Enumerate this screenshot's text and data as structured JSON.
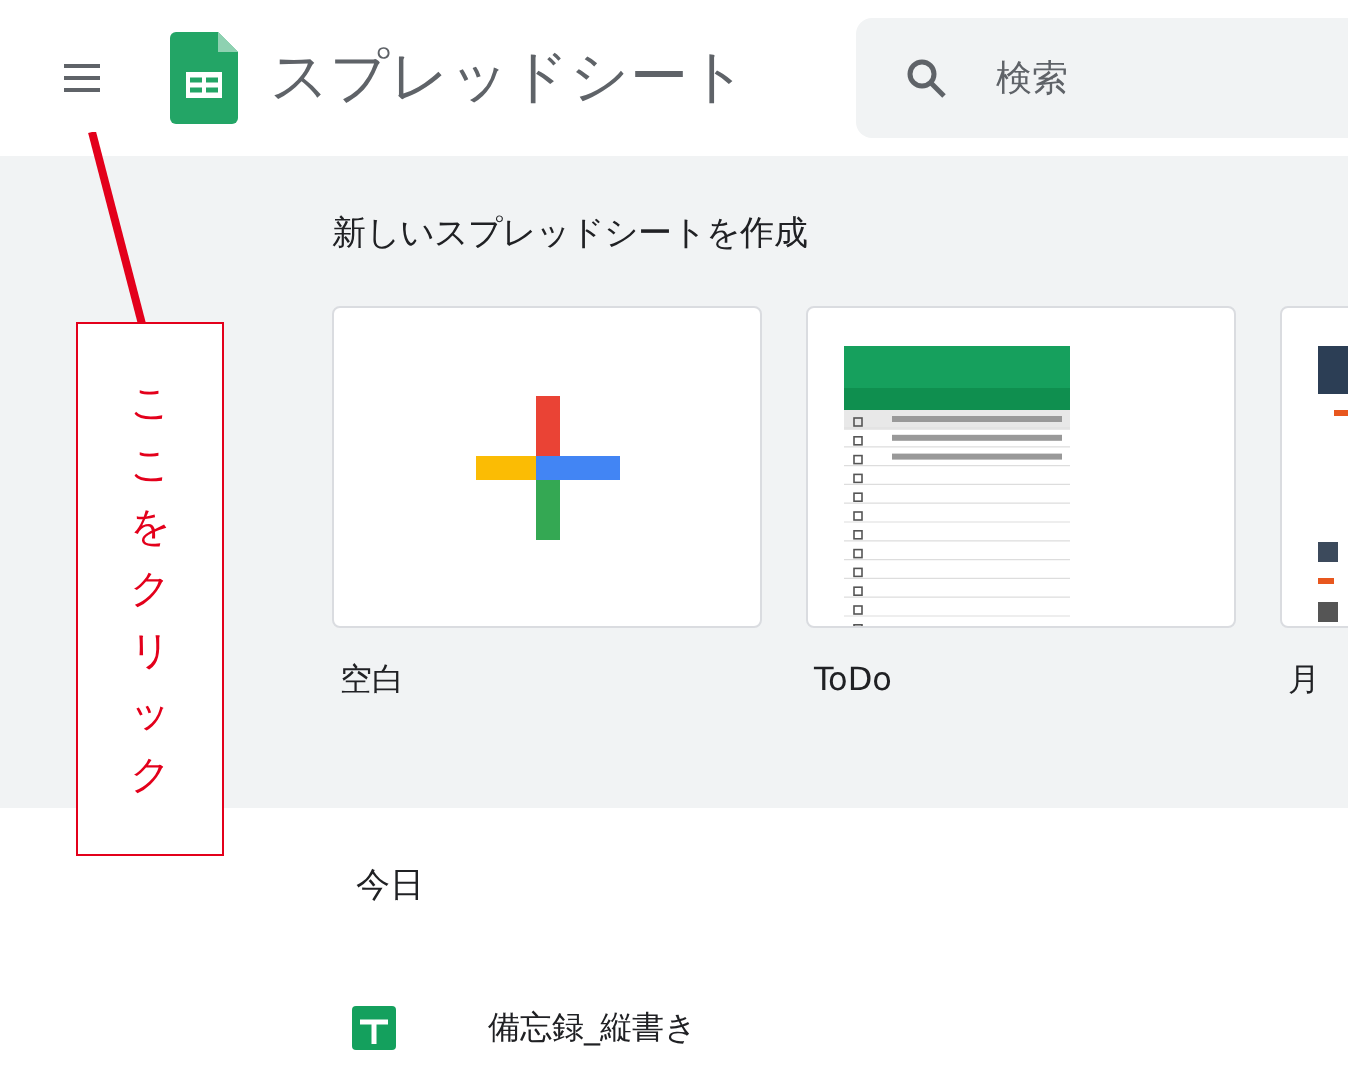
{
  "header": {
    "title": "スプレッドシート",
    "search": {
      "placeholder": "検索"
    }
  },
  "templates": {
    "heading": "新しいスプレッドシートを作成",
    "items": [
      {
        "kind": "blank",
        "label": "空白"
      },
      {
        "kind": "todo",
        "label": "ToDo"
      },
      {
        "kind": "calendar",
        "label": "月"
      }
    ]
  },
  "recent": {
    "heading": "今日",
    "files": [
      {
        "name": "備忘録_縦書き"
      }
    ]
  },
  "annotation": {
    "text": "ここをクリック"
  }
}
